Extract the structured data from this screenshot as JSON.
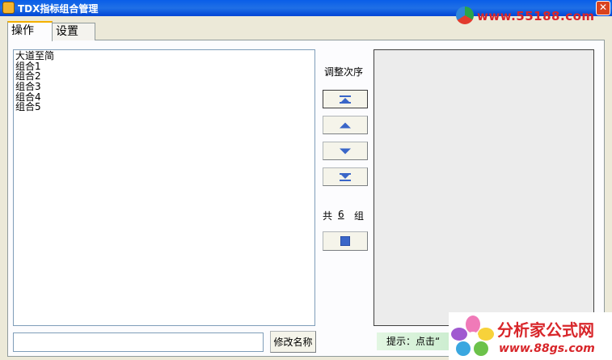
{
  "window": {
    "title": "TDX指标组合管理",
    "close": "✕"
  },
  "tabs": [
    {
      "label": "操作",
      "active": true
    },
    {
      "label": "设置",
      "active": false
    }
  ],
  "list": {
    "items": [
      "大道至简",
      "组合1",
      "组合2",
      "组合3",
      "组合4",
      "组合5"
    ]
  },
  "order": {
    "label": "调整次序",
    "buttons": [
      {
        "name": "move-top",
        "icon": "move-top-icon"
      },
      {
        "name": "move-up",
        "icon": "arrow-up-icon"
      },
      {
        "name": "move-down",
        "icon": "arrow-down-icon"
      },
      {
        "name": "move-bottom",
        "icon": "move-bottom-icon"
      }
    ]
  },
  "count": {
    "prefix": "共",
    "value": "6",
    "suffix": "组"
  },
  "save_button": {
    "icon": "square-icon"
  },
  "rename": {
    "input_value": "",
    "button_label": "修改名称"
  },
  "hint": {
    "text": "提示：点击“"
  },
  "watermarks": {
    "top_url": "www.55188.com",
    "bottom_name": "分析家公式网",
    "bottom_url": "www.88gs.com"
  },
  "colors": {
    "titlebar": "#0a5ee8",
    "accent_icon": "#3a66c8",
    "watermark_red": "#d8262a"
  }
}
